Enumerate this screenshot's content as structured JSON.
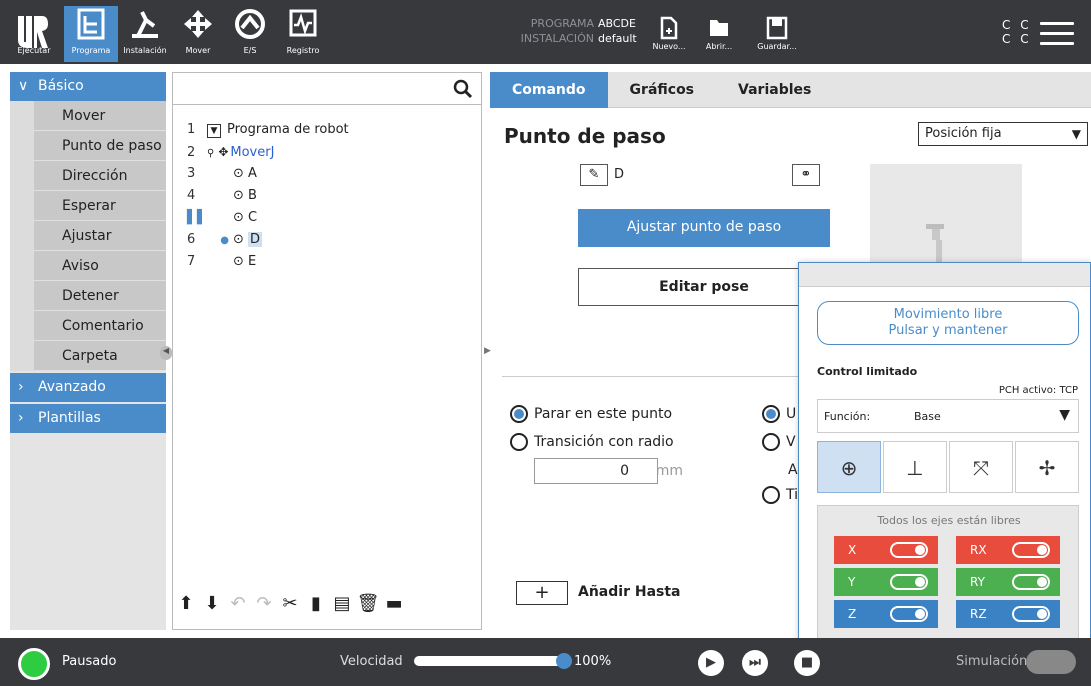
{
  "topbar": {
    "buttons": [
      {
        "label": "Ejecutar",
        "icon": "run-icon"
      },
      {
        "label": "Programa",
        "icon": "program-icon"
      },
      {
        "label": "Instalación",
        "icon": "installation-icon"
      },
      {
        "label": "Mover",
        "icon": "move-icon"
      },
      {
        "label": "E/S",
        "icon": "io-icon"
      },
      {
        "label": "Registro",
        "icon": "log-icon"
      }
    ],
    "program_label": "PROGRAMA",
    "program_value": "ABCDE",
    "installation_label": "INSTALACIÓN",
    "installation_value": "default",
    "file_buttons": [
      {
        "label": "Nuevo...",
        "icon": "new-file-icon"
      },
      {
        "label": "Abrir...",
        "icon": "folder-icon"
      },
      {
        "label": "Guardar...",
        "icon": "save-icon"
      }
    ],
    "cc_line1": "C C",
    "cc_line2": "C C"
  },
  "left": {
    "basic_label": "Básico",
    "items": [
      "Mover",
      "Punto de paso",
      "Dirección",
      "Esperar",
      "Ajustar",
      "Aviso",
      "Detener",
      "Comentario",
      "Carpeta"
    ],
    "advanced_label": "Avanzado",
    "templates_label": "Plantillas"
  },
  "tree": {
    "rows": [
      {
        "num": "1",
        "label": "Programa de robot"
      },
      {
        "num": "2",
        "label": "MoverJ"
      },
      {
        "num": "3",
        "label": "A"
      },
      {
        "num": "4",
        "label": "B"
      },
      {
        "num": "",
        "label": "C"
      },
      {
        "num": "6",
        "label": "D"
      },
      {
        "num": "7",
        "label": "E"
      }
    ]
  },
  "right": {
    "tabs": [
      "Comando",
      "Gráficos",
      "Variables"
    ],
    "title": "Punto de paso",
    "position_select": "Posición fija",
    "waypoint_name": "D",
    "set_waypoint": "Ajustar punto de paso",
    "edit_pose": "Editar pose",
    "radio_stop": "Parar en este punto",
    "radio_blend": "Transición con radio",
    "radius_value": "0",
    "radius_unit": "mm",
    "right_radio1": "U",
    "right_radio2": "V",
    "right_text": "A",
    "right_radio3": "Ti",
    "add_until": "Añadir Hasta"
  },
  "overlay": {
    "freedrive_line1": "Movimiento libre",
    "freedrive_line2": "Pulsar y mantener",
    "limited_label": "Control limitado",
    "tcp_label": "PCH activo: TCP",
    "function_label": "Función:",
    "function_value": "Base",
    "axes_title": "Todos los ejes están libres",
    "axes": [
      {
        "label": "X",
        "color": "#e74c3c"
      },
      {
        "label": "RX",
        "color": "#e74c3c"
      },
      {
        "label": "Y",
        "color": "#4cb050"
      },
      {
        "label": "RY",
        "color": "#4cb050"
      },
      {
        "label": "Z",
        "color": "#3b82c4"
      },
      {
        "label": "RZ",
        "color": "#3b82c4"
      }
    ]
  },
  "bottom": {
    "status": "Pausado",
    "speed_label": "Velocidad",
    "speed_value": "100%",
    "sim_label": "Simulación"
  }
}
